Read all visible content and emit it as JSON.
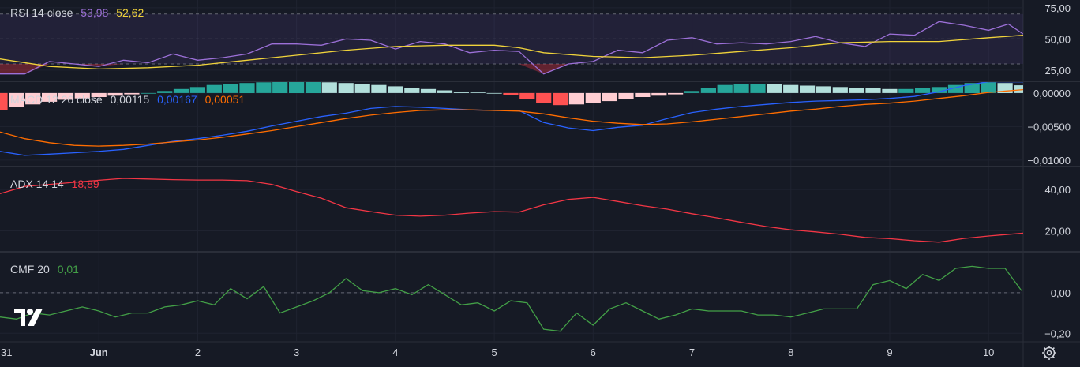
{
  "colors": {
    "background": "#161a25",
    "grid": "#2a2e39",
    "text": "#d1d4dc",
    "rsi": "#9c70d8",
    "rsi_ma": "#f0d33b",
    "macd": "#2962ff",
    "signal": "#ff6d00",
    "hist_pos_strong": "#26a69a",
    "hist_pos_weak": "#b2dfdb",
    "hist_neg_strong": "#ff5252",
    "hist_neg_weak": "#ffcdd2",
    "adx": "#f23645",
    "cmf": "#43a047"
  },
  "icons": {
    "logo": "tradingview-logo-icon",
    "settings": "gear-icon"
  },
  "x_axis": {
    "ticks": [
      {
        "label": "31",
        "t": -0.85,
        "bold": false
      },
      {
        "label": "Jun",
        "t": 1.0,
        "bold": true
      },
      {
        "label": "2",
        "t": 2.0,
        "bold": false
      },
      {
        "label": "3",
        "t": 3.0,
        "bold": false
      },
      {
        "label": "4",
        "t": 4.0,
        "bold": false
      },
      {
        "label": "5",
        "t": 5.0,
        "bold": false
      },
      {
        "label": "6",
        "t": 6.0,
        "bold": false
      },
      {
        "label": "7",
        "t": 7.0,
        "bold": false
      },
      {
        "label": "8",
        "t": 8.0,
        "bold": false
      },
      {
        "label": "9",
        "t": 9.0,
        "bold": false
      },
      {
        "label": "10",
        "t": 10.0,
        "bold": false
      }
    ],
    "range": [
      0.0,
      10.35
    ]
  },
  "legends": {
    "rsi": {
      "label": "RSI 14 close",
      "v1": "53,98",
      "v2": "52,62"
    },
    "macd": {
      "label": "MACD 12 26 close",
      "v1": "0,00115",
      "v2": "0,00167",
      "v3": "0,00051"
    },
    "adx": {
      "label": "ADX 14 14",
      "v1": "18,89"
    },
    "cmf": {
      "label": "CMF 20",
      "v1": "0,01"
    }
  },
  "chart_data": [
    {
      "type": "line",
      "name": "RSI 14 close",
      "y_ticks": [
        {
          "v": 75,
          "label": "75,00"
        },
        {
          "v": 50,
          "label": "50,00"
        },
        {
          "v": 25,
          "label": "25,00"
        }
      ],
      "ylim": [
        18,
        80
      ],
      "band": [
        30,
        70
      ],
      "series": [
        {
          "t": [
            0.0,
            0.25,
            0.5,
            0.75,
            1.0,
            1.25,
            1.5,
            1.75,
            2.0,
            2.25,
            2.5,
            2.75,
            3.0,
            3.25,
            3.5,
            3.75,
            4.0,
            4.25,
            4.5,
            4.75,
            5.0,
            5.25,
            5.5,
            5.75,
            6.0,
            6.25,
            6.5,
            6.75,
            7.0,
            7.25,
            7.5,
            7.75,
            8.0,
            8.25,
            8.5,
            8.75,
            9.0,
            9.25,
            9.5,
            9.75,
            10.0,
            10.2,
            10.35
          ],
          "values": [
            22,
            22,
            32,
            30,
            28,
            33,
            31,
            38,
            33,
            35,
            38,
            46,
            46,
            45,
            50,
            49,
            42,
            48,
            46,
            39,
            41,
            40,
            22,
            30,
            32,
            41,
            39,
            49,
            51,
            46,
            47,
            46,
            48,
            52,
            47,
            44,
            54,
            53,
            64,
            61,
            57,
            62,
            54
          ]
        },
        {
          "t": [
            0.0,
            0.5,
            1.0,
            1.5,
            2.0,
            2.5,
            3.0,
            3.5,
            4.0,
            4.5,
            5.0,
            5.25,
            5.5,
            6.0,
            6.5,
            7.0,
            7.5,
            8.0,
            8.5,
            9.0,
            9.5,
            10.0,
            10.35
          ],
          "values": [
            34,
            28,
            26,
            27,
            29,
            33,
            37,
            41,
            44,
            45,
            45,
            43,
            39,
            36,
            35,
            37,
            40,
            43,
            47,
            48,
            48,
            51,
            53
          ]
        }
      ]
    },
    {
      "type": "bar+line",
      "name": "MACD 12 26 close",
      "y_ticks": [
        {
          "v": 0.0,
          "label": "0,00000"
        },
        {
          "v": -0.005,
          "label": "−0,00500"
        },
        {
          "v": -0.01,
          "label": "−0,01000"
        }
      ],
      "ylim": [
        -0.0106,
        0.0014
      ],
      "histogram": {
        "t": [
          0.0,
          0.167,
          0.333,
          0.5,
          0.667,
          0.833,
          1.0,
          1.167,
          1.333,
          1.5,
          1.667,
          1.833,
          2.0,
          2.167,
          2.333,
          2.5,
          2.667,
          2.833,
          3.0,
          3.167,
          3.333,
          3.5,
          3.667,
          3.833,
          4.0,
          4.167,
          4.333,
          4.5,
          4.667,
          4.833,
          5.0,
          5.167,
          5.333,
          5.5,
          5.667,
          5.833,
          6.0,
          6.167,
          6.333,
          6.5,
          6.667,
          6.833,
          7.0,
          7.167,
          7.333,
          7.5,
          7.667,
          7.833,
          8.0,
          8.167,
          8.333,
          8.5,
          8.667,
          8.833,
          9.0,
          9.167,
          9.333,
          9.5,
          9.667,
          9.833,
          10.0,
          10.167,
          10.333
        ],
        "values": [
          -0.0025,
          -0.0021,
          -0.0017,
          -0.0013,
          -0.001,
          -0.0008,
          -0.0006,
          -0.0004,
          -0.0002,
          0.0,
          0.0003,
          0.0006,
          0.0009,
          0.0012,
          0.0014,
          0.0015,
          0.0016,
          0.0017,
          0.0017,
          0.0017,
          0.0016,
          0.0015,
          0.0014,
          0.0012,
          0.001,
          0.0008,
          0.0006,
          0.0004,
          0.0002,
          0.0001,
          0.0,
          -0.0003,
          -0.0009,
          -0.0015,
          -0.0018,
          -0.0017,
          -0.0015,
          -0.0012,
          -0.0009,
          -0.0006,
          -0.0004,
          -0.0002,
          0.0003,
          0.0008,
          0.0012,
          0.0014,
          0.0014,
          0.0013,
          0.0012,
          0.0011,
          0.001,
          0.0009,
          0.0008,
          0.0007,
          0.0006,
          0.0006,
          0.0007,
          0.0009,
          0.0012,
          0.0015,
          0.0016,
          0.0015,
          0.00115
        ]
      },
      "series": [
        {
          "t": [
            0.0,
            0.25,
            0.5,
            0.75,
            1.0,
            1.25,
            1.5,
            1.75,
            2.0,
            2.25,
            2.5,
            2.75,
            3.0,
            3.25,
            3.5,
            3.75,
            4.0,
            4.25,
            4.5,
            4.75,
            5.0,
            5.25,
            5.5,
            5.75,
            6.0,
            6.25,
            6.5,
            6.75,
            7.0,
            7.25,
            7.5,
            7.75,
            8.0,
            8.25,
            8.5,
            8.75,
            9.0,
            9.25,
            9.5,
            9.75,
            10.0,
            10.35
          ],
          "values": [
            -0.0087,
            -0.0093,
            -0.0091,
            -0.0089,
            -0.0087,
            -0.0084,
            -0.0078,
            -0.0072,
            -0.0068,
            -0.0063,
            -0.0057,
            -0.0049,
            -0.0042,
            -0.0035,
            -0.003,
            -0.0023,
            -0.002,
            -0.0021,
            -0.0023,
            -0.0025,
            -0.0026,
            -0.0026,
            -0.0044,
            -0.0052,
            -0.0056,
            -0.0051,
            -0.0048,
            -0.0038,
            -0.0029,
            -0.0024,
            -0.002,
            -0.0017,
            -0.0014,
            -0.0012,
            -0.0011,
            -0.001,
            -0.0008,
            -0.0005,
            0.0002,
            0.0011,
            0.0017,
            0.00167
          ]
        },
        {
          "t": [
            0.0,
            0.25,
            0.5,
            0.75,
            1.0,
            1.25,
            1.5,
            1.75,
            2.0,
            2.25,
            2.5,
            2.75,
            3.0,
            3.25,
            3.5,
            3.75,
            4.0,
            4.25,
            4.5,
            4.75,
            5.0,
            5.25,
            5.5,
            5.75,
            6.0,
            6.25,
            6.5,
            6.75,
            7.0,
            7.25,
            7.5,
            7.75,
            8.0,
            8.25,
            8.5,
            8.75,
            9.0,
            9.25,
            9.5,
            9.75,
            10.0,
            10.35
          ],
          "values": [
            -0.0058,
            -0.0068,
            -0.0074,
            -0.0078,
            -0.0079,
            -0.0078,
            -0.0076,
            -0.0073,
            -0.007,
            -0.0066,
            -0.0061,
            -0.0056,
            -0.005,
            -0.0044,
            -0.0038,
            -0.0033,
            -0.0029,
            -0.0026,
            -0.0025,
            -0.0025,
            -0.0026,
            -0.0027,
            -0.0031,
            -0.0037,
            -0.0042,
            -0.0045,
            -0.0047,
            -0.0046,
            -0.0043,
            -0.0039,
            -0.0035,
            -0.0031,
            -0.0027,
            -0.0024,
            -0.002,
            -0.0017,
            -0.0015,
            -0.0012,
            -0.0008,
            -0.0004,
            0.0001,
            0.00051
          ]
        }
      ]
    },
    {
      "type": "line",
      "name": "ADX 14 14",
      "y_ticks": [
        {
          "v": 40,
          "label": "40,00"
        },
        {
          "v": 20,
          "label": "20,00"
        }
      ],
      "ylim": [
        11,
        50
      ],
      "series": [
        {
          "t": [
            0.0,
            0.25,
            0.5,
            0.75,
            1.0,
            1.25,
            1.5,
            1.75,
            2.0,
            2.25,
            2.5,
            2.75,
            3.0,
            3.25,
            3.5,
            3.75,
            4.0,
            4.25,
            4.5,
            4.75,
            5.0,
            5.25,
            5.5,
            5.75,
            6.0,
            6.25,
            6.5,
            6.75,
            7.0,
            7.25,
            7.5,
            7.75,
            8.0,
            8.25,
            8.5,
            8.75,
            9.0,
            9.25,
            9.5,
            9.75,
            10.0,
            10.35
          ],
          "values": [
            38,
            41.5,
            42.5,
            43.5,
            44.5,
            45.4,
            45.1,
            44.8,
            44.6,
            44.6,
            44.3,
            42.5,
            39,
            35.8,
            31.2,
            29.3,
            27.6,
            27.1,
            27.6,
            28.6,
            29.3,
            29.1,
            32.6,
            35.2,
            36.2,
            34.2,
            32.2,
            30.5,
            28.3,
            26.3,
            24.1,
            22.1,
            20.5,
            19.5,
            18.3,
            16.8,
            16.2,
            15.2,
            14.5,
            16.3,
            17.5,
            18.89
          ]
        }
      ]
    },
    {
      "type": "line",
      "name": "CMF 20",
      "y_ticks": [
        {
          "v": 0.0,
          "label": "0,00"
        },
        {
          "v": -0.2,
          "label": "−0,20"
        }
      ],
      "ylim": [
        -0.23,
        0.19
      ],
      "series": [
        {
          "t": [
            0.0,
            0.167,
            0.333,
            0.5,
            0.667,
            0.833,
            1.0,
            1.167,
            1.333,
            1.5,
            1.667,
            1.833,
            2.0,
            2.167,
            2.333,
            2.5,
            2.667,
            2.833,
            3.0,
            3.167,
            3.333,
            3.5,
            3.667,
            3.833,
            4.0,
            4.167,
            4.333,
            4.5,
            4.667,
            4.833,
            5.0,
            5.167,
            5.333,
            5.5,
            5.667,
            5.833,
            6.0,
            6.167,
            6.333,
            6.5,
            6.667,
            6.833,
            7.0,
            7.167,
            7.333,
            7.5,
            7.667,
            7.833,
            8.0,
            8.167,
            8.333,
            8.5,
            8.667,
            8.833,
            9.0,
            9.167,
            9.333,
            9.5,
            9.667,
            9.833,
            10.0,
            10.167,
            10.333
          ],
          "values": [
            -0.12,
            -0.13,
            -0.1,
            -0.11,
            -0.09,
            -0.07,
            -0.09,
            -0.12,
            -0.1,
            -0.1,
            -0.07,
            -0.06,
            -0.04,
            -0.06,
            0.02,
            -0.03,
            0.03,
            -0.1,
            -0.07,
            -0.04,
            0.0,
            0.07,
            0.01,
            0.0,
            0.02,
            -0.01,
            0.04,
            -0.01,
            -0.06,
            -0.05,
            -0.09,
            -0.04,
            -0.05,
            -0.18,
            -0.19,
            -0.1,
            -0.16,
            -0.08,
            -0.05,
            -0.09,
            -0.13,
            -0.11,
            -0.08,
            -0.09,
            -0.09,
            -0.09,
            -0.11,
            -0.11,
            -0.12,
            -0.1,
            -0.08,
            -0.08,
            -0.08,
            0.04,
            0.06,
            0.02,
            0.09,
            0.06,
            0.12,
            0.13,
            0.12,
            0.12,
            0.01
          ]
        }
      ]
    }
  ]
}
